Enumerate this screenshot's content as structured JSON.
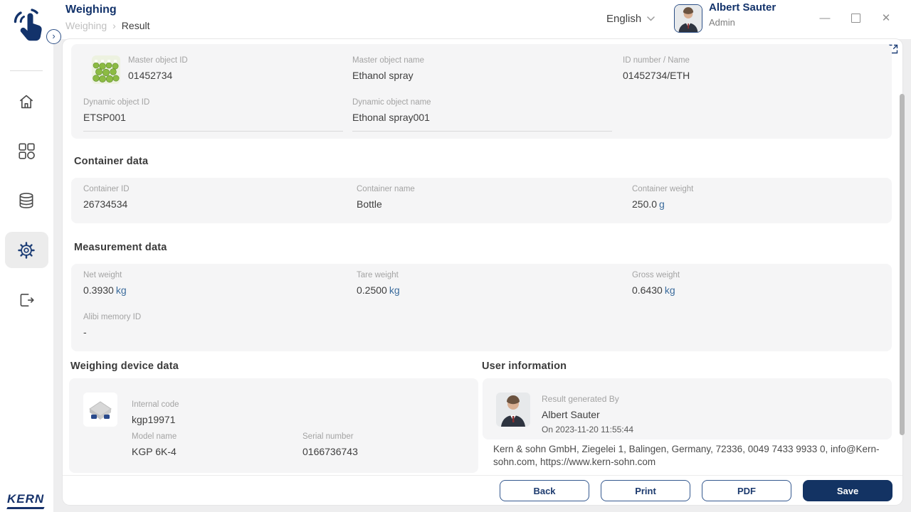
{
  "page": {
    "title": "Weighing",
    "breadcrumb_parent": "Weighing",
    "breadcrumb_sep": "›",
    "breadcrumb_current": "Result"
  },
  "window": {
    "language_label": "English",
    "user_name": "Albert Sauter",
    "user_role": "Admin",
    "minimize_glyph": "—",
    "close_glyph": "✕",
    "toggle_glyph": "›"
  },
  "sidebar": {
    "items": [
      {
        "name": "home"
      },
      {
        "name": "dashboard"
      },
      {
        "name": "database"
      },
      {
        "name": "settings",
        "active": true
      },
      {
        "name": "exit"
      }
    ],
    "logo_text": "KERN"
  },
  "master": {
    "master_id_label": "Master object ID",
    "master_id": "01452734",
    "master_name_label": "Master object name",
    "master_name": "Ethanol spray",
    "id_number_label": "ID number / Name",
    "id_number": "01452734/ETH",
    "dynamic_id_label": "Dynamic object ID",
    "dynamic_id": "ETSP001",
    "dynamic_name_label": "Dynamic object name",
    "dynamic_name": "Ethonal spray001"
  },
  "container": {
    "heading": "Container data",
    "id_label": "Container ID",
    "id": "26734534",
    "name_label": "Container name",
    "name": "Bottle",
    "weight_label": "Container weight",
    "weight": "250.0",
    "weight_unit": "g"
  },
  "measurement": {
    "heading": "Measurement data",
    "net_label": "Net weight",
    "net": "0.3930",
    "net_unit": "kg",
    "tare_label": "Tare weight",
    "tare": "0.2500",
    "tare_unit": "kg",
    "gross_label": "Gross weight",
    "gross": "0.6430",
    "gross_unit": "kg",
    "alibi_label": "Alibi memory ID",
    "alibi": "-"
  },
  "device": {
    "heading": "Weighing device data",
    "internal_code_label": "Internal code",
    "internal_code": "kgp19971",
    "model_label": "Model name",
    "model": "KGP 6K-4",
    "serial_label": "Serial number",
    "serial": "0166736743"
  },
  "user_info": {
    "heading": "User information",
    "generated_by_label": "Result generated By",
    "generated_by": "Albert Sauter",
    "generated_on": "On 2023-11-20 11:55:44",
    "company": "Kern & sohn GmbH, Ziegelei 1, Balingen, Germany, 72336, 0049 7433 9933 0, info@Kern-sohn.com, https://www.kern-sohn.com"
  },
  "footer": {
    "back": "Back",
    "print": "Print",
    "pdf": "PDF",
    "save": "Save"
  },
  "colors": {
    "accent_navy": "#13336b",
    "unit_blue": "#3a6b9c",
    "card_bg": "#f5f5f6"
  }
}
